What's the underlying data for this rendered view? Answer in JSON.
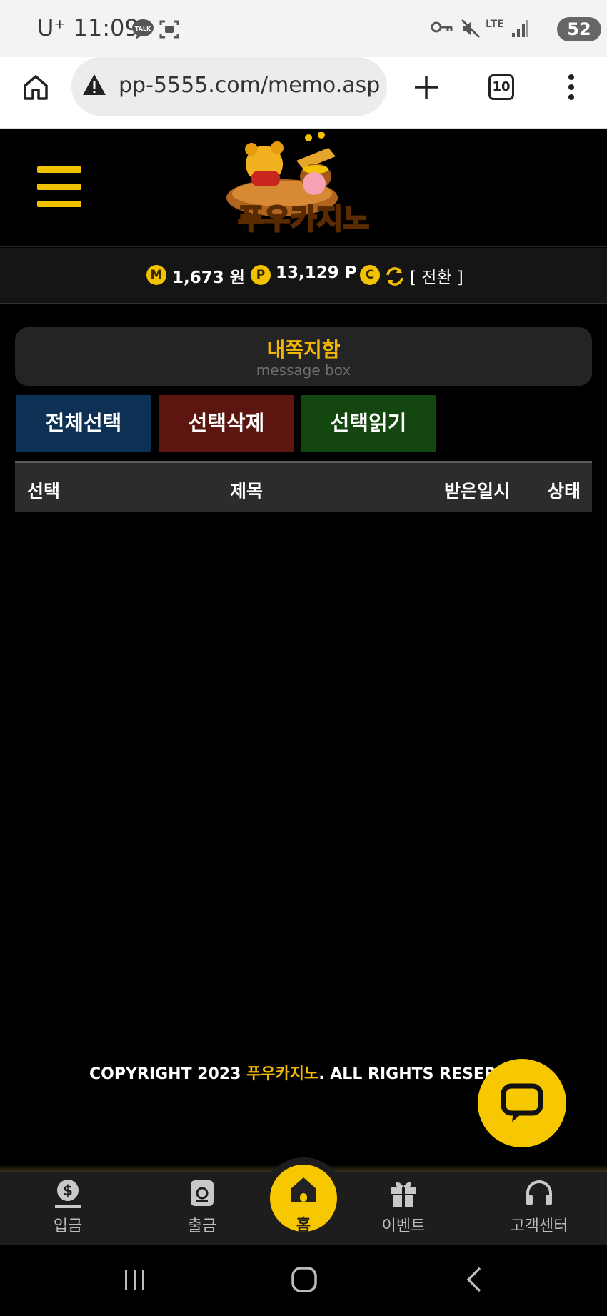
{
  "status_bar": {
    "carrier": "U⁺",
    "time": "11:09",
    "talk_label": "TALK",
    "network": "LTE",
    "battery": "52"
  },
  "browser": {
    "url": "pp-5555.com/memo.asp",
    "tab_count": "10"
  },
  "site": {
    "logo_text": "푸우카지노"
  },
  "balance": {
    "money_icon_letter": "M",
    "money": "1,673 원",
    "point_icon_letter": "P",
    "points": "13,129 P",
    "convert_icon_letter": "C",
    "convert_label": "[ 전환 ]"
  },
  "message_box": {
    "title": "내쪽지함",
    "subtitle": "message box"
  },
  "actions": {
    "select_all": "전체선택",
    "delete_selected": "선택삭제",
    "read_selected": "선택읽기"
  },
  "table": {
    "columns": [
      "선택",
      "제목",
      "받은일시",
      "상태"
    ],
    "rows": []
  },
  "footer": {
    "copyright_prefix": "COPYRIGHT 2023 ",
    "copyright_brand": "푸우카지노",
    "copyright_suffix": ". ALL RIGHTS RESERVED"
  },
  "bottom_nav": {
    "items": [
      {
        "label": "입금",
        "icon": "deposit-icon"
      },
      {
        "label": "출금",
        "icon": "withdraw-icon"
      },
      {
        "label": "홈",
        "icon": "home-icon"
      },
      {
        "label": "이벤트",
        "icon": "gift-icon"
      },
      {
        "label": "고객센터",
        "icon": "headset-icon"
      }
    ]
  },
  "colors": {
    "accent": "#f2b705",
    "fab": "#f7c800",
    "btn_blue": "#0d3055",
    "btn_red": "#5c150f",
    "btn_green": "#14460f"
  }
}
